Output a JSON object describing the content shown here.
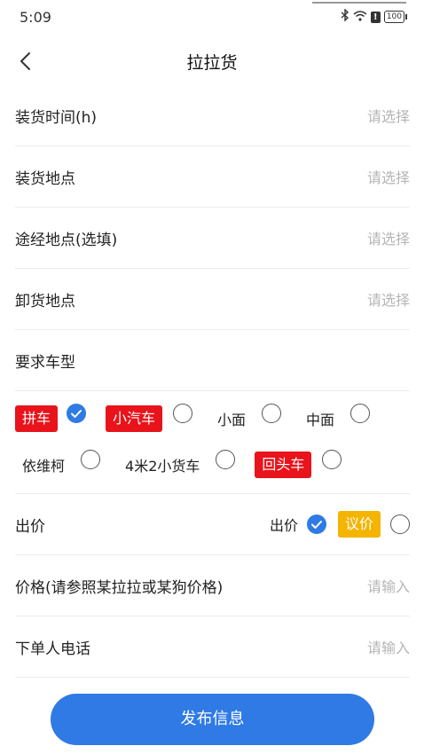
{
  "status_bar": {
    "time": "5:09",
    "icons": [
      "bluetooth-icon",
      "wifi-icon",
      "alert-icon",
      "battery-icon"
    ],
    "alert_text": "!",
    "battery": "100"
  },
  "header": {
    "title": "拉拉货",
    "back_icon": "chevron-left-icon"
  },
  "form": {
    "loading_time": {
      "label": "装货时间(h)",
      "placeholder": "请选择"
    },
    "loading_place": {
      "label": "装货地点",
      "placeholder": "请选择"
    },
    "via_place": {
      "label": "途经地点(选填)",
      "placeholder": "请选择"
    },
    "unloading_place": {
      "label": "卸货地点",
      "placeholder": "请选择"
    },
    "vehicle_type": {
      "label": "要求车型",
      "options": [
        {
          "label": "拼车",
          "style": "red-tag",
          "checked": true
        },
        {
          "label": "小汽车",
          "style": "red-tag",
          "checked": false
        },
        {
          "label": "小面",
          "style": "plain",
          "checked": false
        },
        {
          "label": "中面",
          "style": "plain",
          "checked": false
        },
        {
          "label": "依维柯",
          "style": "plain",
          "checked": false
        },
        {
          "label": "4米2小货车",
          "style": "plain",
          "checked": false
        },
        {
          "label": "回头车",
          "style": "red-tag",
          "checked": false
        }
      ]
    },
    "bid": {
      "label": "出价",
      "options": [
        {
          "label": "出价",
          "style": "plain",
          "checked": true
        },
        {
          "label": "议价",
          "style": "yellow-tag",
          "checked": false
        }
      ]
    },
    "price": {
      "label": "价格(请参照某拉拉或某狗价格)",
      "placeholder": "请输入"
    },
    "phone": {
      "label": "下单人电话",
      "placeholder": "请输入"
    }
  },
  "actions": {
    "submit_label": "发布信息"
  },
  "colors": {
    "accent": "#2f7ae5",
    "tag_red": "#e8131b",
    "tag_yellow": "#f5b400",
    "placeholder": "#b5b5b5"
  }
}
